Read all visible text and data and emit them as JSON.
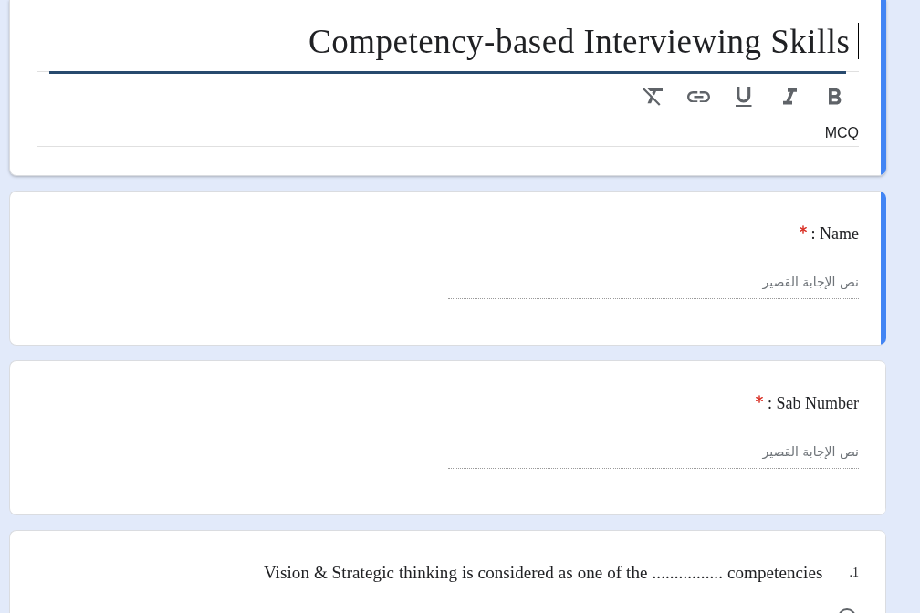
{
  "form_header": {
    "focused": true,
    "title": "Competency-based Interviewing Skills",
    "description": "MCQ"
  },
  "questions": [
    {
      "kind": "short_answer",
      "focused": true,
      "label": ": Name",
      "required": true,
      "placeholder": "نص الإجابة القصير"
    },
    {
      "kind": "short_answer",
      "focused": false,
      "label": ": Sab Number",
      "required": true,
      "placeholder": "نص الإجابة القصير"
    },
    {
      "kind": "multiple_choice",
      "focused": false,
      "number": "1.",
      "label": "Vision & Strategic thinking is considered as one of the ................ competencies",
      "required": false,
      "options": [
        {
          "selected": false
        }
      ]
    }
  ]
}
